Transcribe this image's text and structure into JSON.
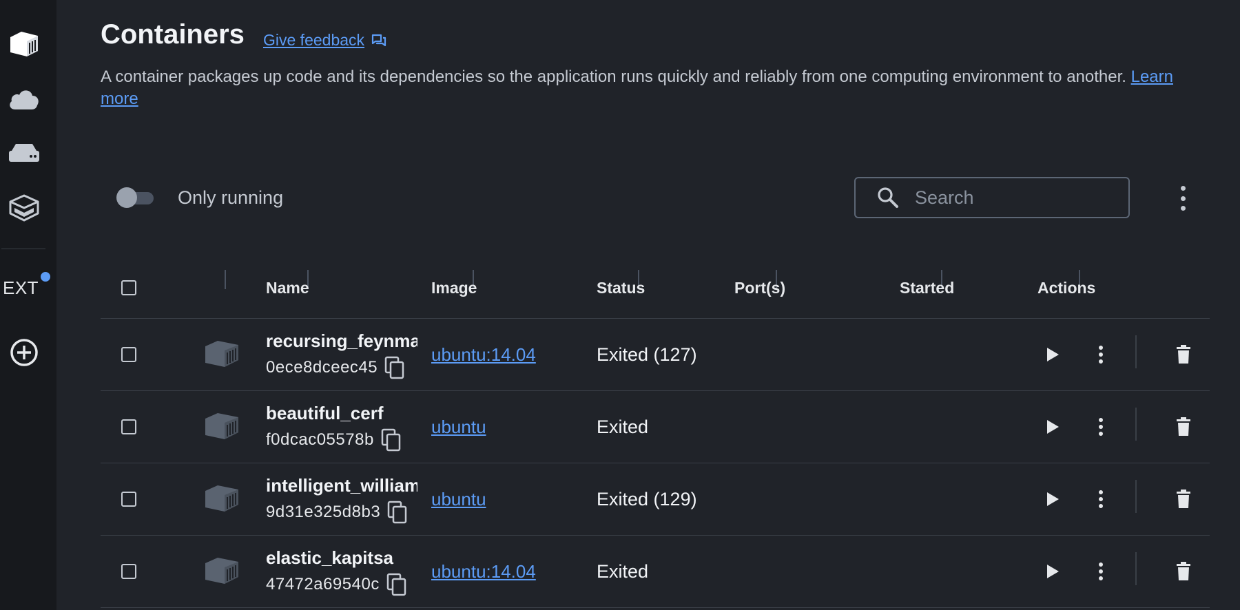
{
  "sidebar": {
    "items": [
      {
        "icon": "containers-icon"
      },
      {
        "icon": "cloud-icon"
      },
      {
        "icon": "volumes-icon"
      },
      {
        "icon": "dev-environments-icon"
      }
    ],
    "ext_label": "EXT",
    "add_extension_icon": "add-circle-icon"
  },
  "header": {
    "title": "Containers",
    "feedback_label": "Give feedback",
    "description": "A container packages up code and its dependencies so the application runs quickly and reliably from one computing environment to another.",
    "learn_more": "Learn more"
  },
  "toolbar": {
    "only_running_label": "Only running",
    "only_running": false,
    "search_placeholder": "Search"
  },
  "table": {
    "columns": [
      "Name",
      "Image",
      "Status",
      "Port(s)",
      "Started",
      "Actions"
    ],
    "rows": [
      {
        "name": "recursing_feynman",
        "id": "0ece8dceec45",
        "image": "ubuntu:14.04",
        "status": "Exited (127)",
        "ports": "",
        "started": ""
      },
      {
        "name": "beautiful_cerf",
        "id": "f0dcac05578b",
        "image": "ubuntu",
        "status": "Exited",
        "ports": "",
        "started": ""
      },
      {
        "name": "intelligent_williams",
        "id": "9d31e325d8b3",
        "image": "ubuntu",
        "status": "Exited (129)",
        "ports": "",
        "started": ""
      },
      {
        "name": "elastic_kapitsa",
        "id": "47472a69540c",
        "image": "ubuntu:14.04",
        "status": "Exited",
        "ports": "",
        "started": ""
      }
    ]
  },
  "colors": {
    "background": "#202329",
    "sidebar": "#17191d",
    "link": "#5c9cf6",
    "text": "#e6e8eb"
  }
}
